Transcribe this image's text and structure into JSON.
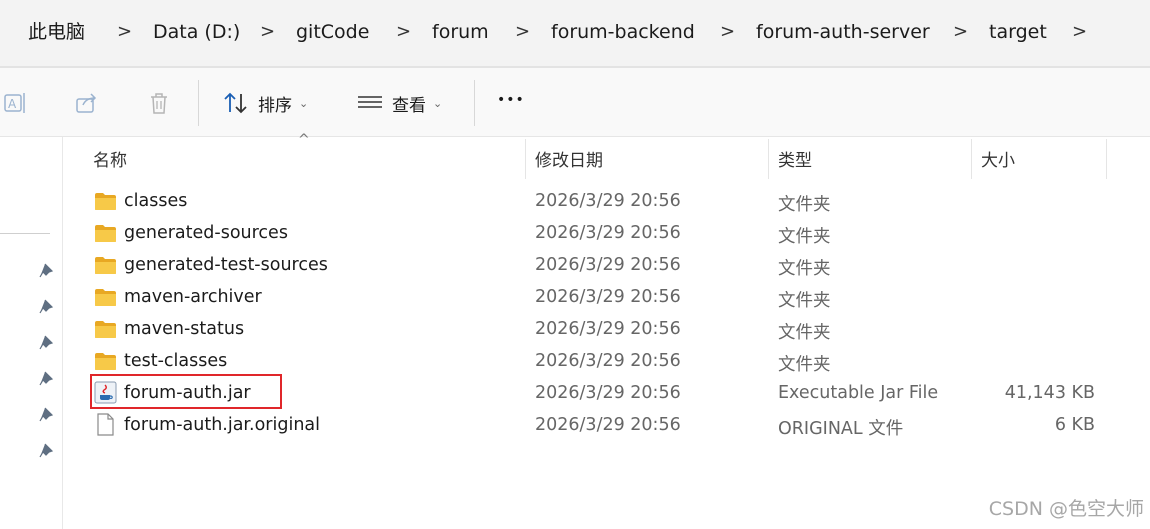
{
  "breadcrumb": {
    "items": [
      "此电脑",
      "Data (D:)",
      "gitCode",
      "forum",
      "forum-backend",
      "forum-auth-server",
      "target"
    ],
    "separator": ">"
  },
  "toolbar": {
    "sort_label": "排序",
    "view_label": "查看",
    "more_label": "•••",
    "caret": "⌄"
  },
  "columns": {
    "name": "名称",
    "modified": "修改日期",
    "type": "类型",
    "size": "大小",
    "sort_indicator": "^"
  },
  "files": [
    {
      "name": "classes",
      "modified": "2026/3/29 20:56",
      "type": "文件夹",
      "size": "",
      "icon": "folder-icon"
    },
    {
      "name": "generated-sources",
      "modified": "2026/3/29 20:56",
      "type": "文件夹",
      "size": "",
      "icon": "folder-icon"
    },
    {
      "name": "generated-test-sources",
      "modified": "2026/3/29 20:56",
      "type": "文件夹",
      "size": "",
      "icon": "folder-icon"
    },
    {
      "name": "maven-archiver",
      "modified": "2026/3/29 20:56",
      "type": "文件夹",
      "size": "",
      "icon": "folder-icon"
    },
    {
      "name": "maven-status",
      "modified": "2026/3/29 20:56",
      "type": "文件夹",
      "size": "",
      "icon": "folder-icon"
    },
    {
      "name": "test-classes",
      "modified": "2026/3/29 20:56",
      "type": "文件夹",
      "size": "",
      "icon": "folder-icon"
    },
    {
      "name": "forum-auth.jar",
      "modified": "2026/3/29 20:56",
      "type": "Executable Jar File",
      "size": "41,143 KB",
      "icon": "java-jar-icon"
    },
    {
      "name": "forum-auth.jar.original",
      "modified": "2026/3/29 20:56",
      "type": "ORIGINAL 文件",
      "size": "6 KB",
      "icon": "blank-file-icon"
    }
  ],
  "watermark": "CSDN @色空大师",
  "colors": {
    "highlight": "#e0262a",
    "folder": "#f7c948",
    "toolbar_icon": "#1a5fb4"
  }
}
